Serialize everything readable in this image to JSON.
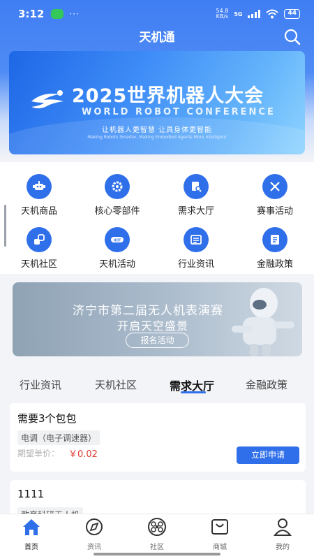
{
  "status_bar": {
    "time": "3:12",
    "dots": "···",
    "speed_top": "54.8",
    "speed_unit": "KB/s",
    "network": "5G",
    "battery": "44"
  },
  "header": {
    "title": "天机通"
  },
  "banner": {
    "title": "2025世界机器人大会",
    "subtitle": "WORLD ROBOT CONFERENCE",
    "slogan": "让机器人更智慧  让具身体更智能",
    "slogan_en": "Making Robots Smarter, Making Embodied Agents More Intelligent"
  },
  "menu": [
    {
      "label": "天机商品",
      "icon": "robot-product-icon"
    },
    {
      "label": "核心零部件",
      "icon": "gear-icon"
    },
    {
      "label": "需求大厅",
      "icon": "document-search-icon"
    },
    {
      "label": "赛事活动",
      "icon": "crossed-swords-icon"
    },
    {
      "label": "天机社区",
      "icon": "community-icon"
    },
    {
      "label": "天机活动",
      "icon": "hot-icon"
    },
    {
      "label": "行业资讯",
      "icon": "news-icon"
    },
    {
      "label": "金融政策",
      "icon": "policy-icon"
    }
  ],
  "promo": {
    "title": "济宁市第二届无人机表演赛",
    "subtitle": "开启天空盛景",
    "button": "报名活动"
  },
  "tabs": [
    {
      "label": "行业资讯",
      "active": false
    },
    {
      "label": "天机社区",
      "active": false
    },
    {
      "label": "需求大厅",
      "active": true
    },
    {
      "label": "金融政策",
      "active": false
    }
  ],
  "cards": [
    {
      "title": "需要3个包包",
      "tag": "电调（电子调速器）",
      "price_label": "期望单价：",
      "price": "￥0.02",
      "button": "立即申请"
    },
    {
      "title": "1111",
      "tag": "教育科研无人机"
    }
  ],
  "bottom_nav": [
    {
      "label": "首页",
      "icon": "home-icon",
      "active": true
    },
    {
      "label": "资讯",
      "icon": "compass-icon",
      "active": false
    },
    {
      "label": "社区",
      "icon": "drone-icon",
      "active": false
    },
    {
      "label": "商城",
      "icon": "shopping-bag-icon",
      "active": false
    },
    {
      "label": "我的",
      "icon": "user-icon",
      "active": false
    }
  ],
  "colors": {
    "primary": "#2f6fe9",
    "price": "#e03a2f"
  }
}
